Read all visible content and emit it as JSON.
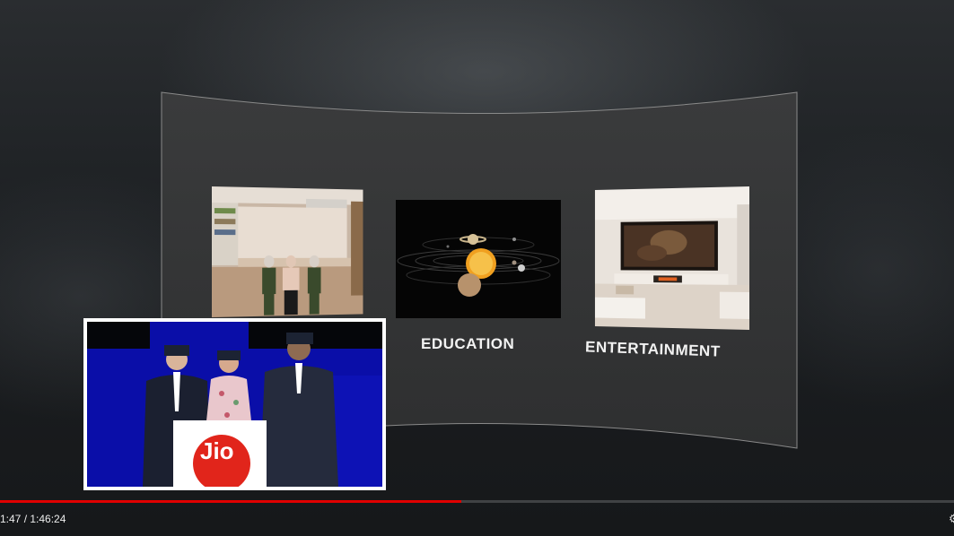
{
  "tiles": [
    {
      "id": "shop",
      "label": ""
    },
    {
      "id": "education",
      "label": "EDUCATION"
    },
    {
      "id": "entertainment",
      "label": "ENTERTAINMENT"
    }
  ],
  "pip": {
    "brand": "Jio",
    "brand_color": "#e1251b"
  },
  "player": {
    "current_time": "1:47",
    "duration": "1:46:24",
    "time_display": "1:47 / 1:46:24",
    "progress_fraction": 0.484,
    "progress_color": "#e00000"
  },
  "icons": {
    "settings": "settings-icon"
  }
}
